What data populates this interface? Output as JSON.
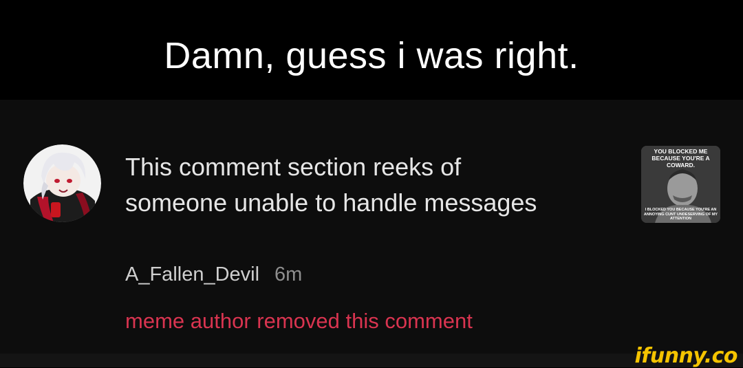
{
  "caption": "Damn, guess i was right.",
  "comment": {
    "text": "This comment section reeks of someone unable to handle messages",
    "author": "A_Fallen_Devil",
    "time": "6m",
    "removed_notice": "meme author removed this comment",
    "removed_color": "#d93450"
  },
  "thumbnail": {
    "top_text": "YOU BLOCKED ME BECAUSE YOU'RE A COWARD.",
    "bottom_text": "I BLOCKED YOU BECAUSE YOU'RE AN ANNOYING CUNT UNDESERVING OF MY ATTENTION"
  },
  "watermark": "ifunny.co",
  "colors": {
    "background": "#000000",
    "card": "#0d0d0d",
    "watermark": "#f5c400"
  }
}
